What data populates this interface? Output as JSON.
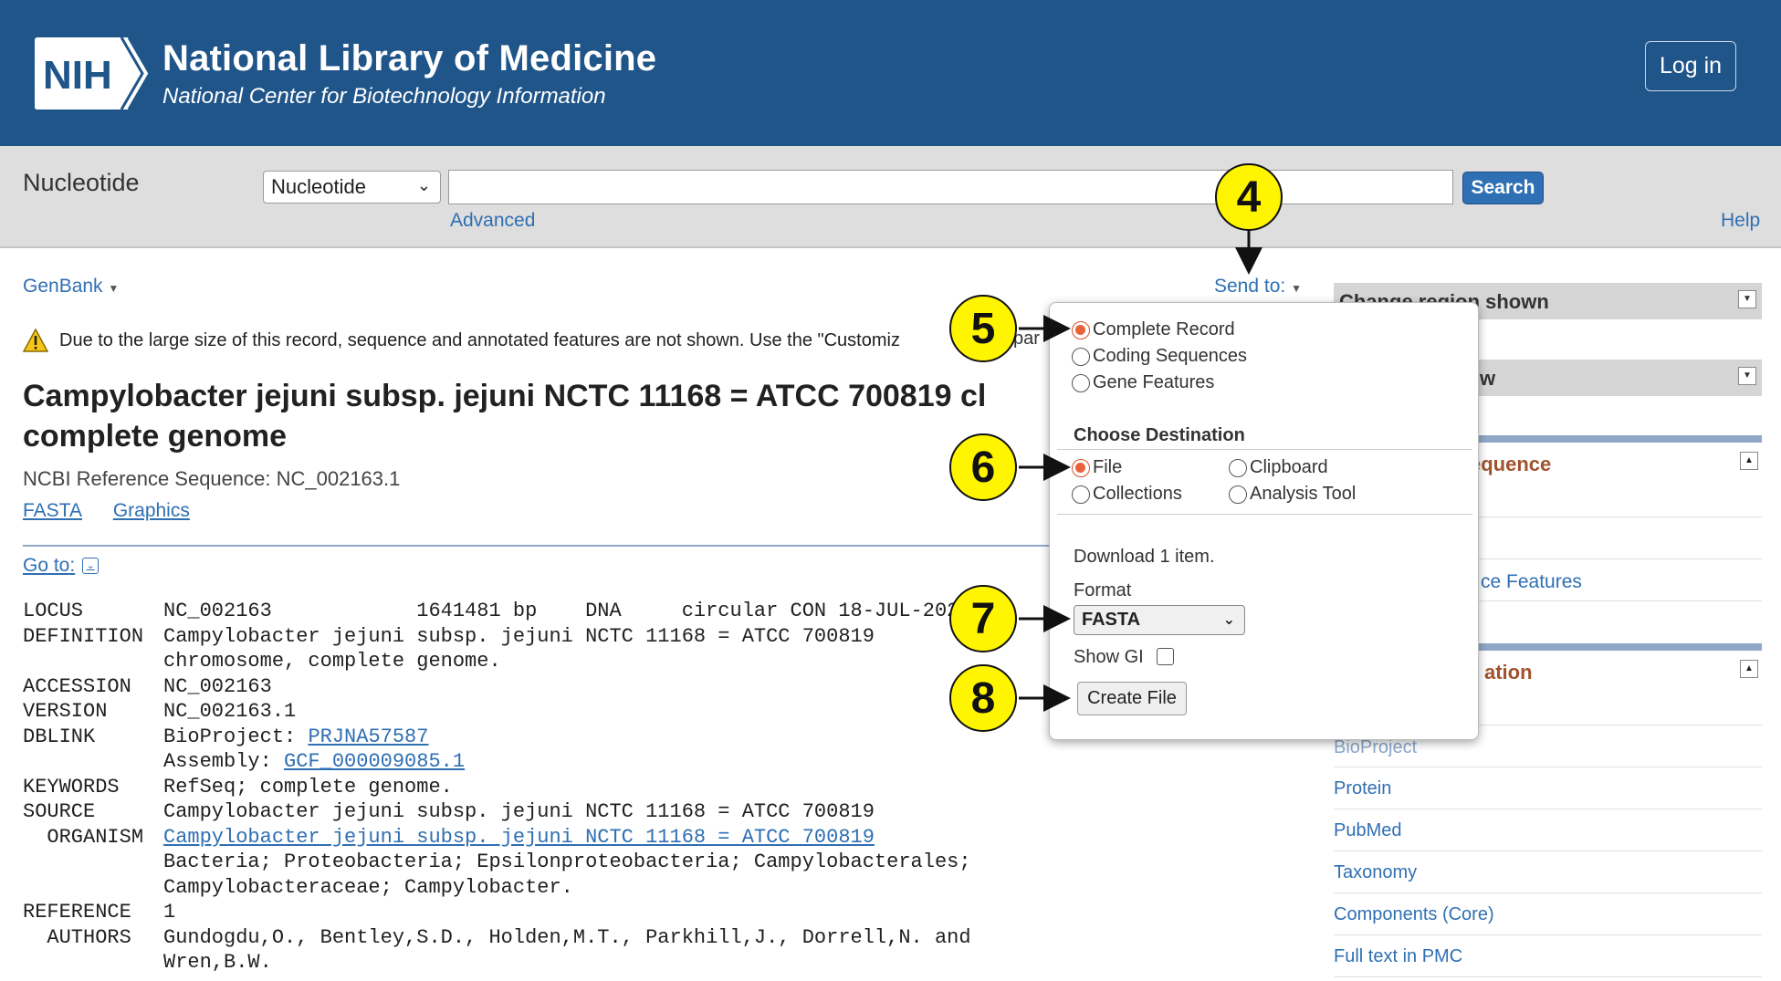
{
  "header": {
    "logo_text": "NIH",
    "title": "National Library of Medicine",
    "subtitle": "National Center for Biotechnology Information",
    "login_label": "Log in",
    "bg_color": "#20558a"
  },
  "search": {
    "db_title": "Nucleotide",
    "db_selected": "Nucleotide",
    "query": "",
    "search_label": "Search",
    "advanced_label": "Advanced",
    "help_label": "Help"
  },
  "toolbar": {
    "format_label": "GenBank",
    "sendto_label": "Send to:"
  },
  "record": {
    "warning": "Due to the large size of this record, sequence and annotated features are not shown. Use the \"Customiz",
    "warning_tail": "par",
    "title_line1": "Campylobacter jejuni subsp. jejuni NCTC 11168 = ATCC 700819 cl",
    "title_line2": "complete genome",
    "refseq": "NCBI Reference Sequence: NC_002163.1",
    "links": [
      "FASTA",
      "Graphics"
    ],
    "goto_label": "Go to:"
  },
  "genbank_rows": [
    {
      "key": "LOCUS",
      "val": "NC_002163            1641481 bp    DNA     circular CON 18-JUL-2022"
    },
    {
      "key": "DEFINITION",
      "val": "Campylobacter jejuni subsp. jejuni NCTC 11168 = ATCC 700819"
    },
    {
      "key": "",
      "val": "chromosome, complete genome."
    },
    {
      "key": "ACCESSION",
      "val": "NC_002163"
    },
    {
      "key": "VERSION",
      "val": "NC_002163.1"
    },
    {
      "key": "DBLINK",
      "val": "BioProject: ",
      "link": "PRJNA57587"
    },
    {
      "key": "",
      "val": "Assembly: ",
      "link": "GCF_000009085.1"
    },
    {
      "key": "KEYWORDS",
      "val": "RefSeq; complete genome."
    },
    {
      "key": "SOURCE",
      "val": "Campylobacter jejuni subsp. jejuni NCTC 11168 = ATCC 700819"
    },
    {
      "key": "  ORGANISM",
      "val": "",
      "link": "Campylobacter jejuni subsp. jejuni NCTC 11168 = ATCC 700819"
    },
    {
      "key": "",
      "val": "Bacteria; Proteobacteria; Epsilonproteobacteria; Campylobacterales;"
    },
    {
      "key": "",
      "val": "Campylobacteraceae; Campylobacter."
    },
    {
      "key": "REFERENCE",
      "val": "1"
    },
    {
      "key": "  AUTHORS",
      "val": "Gundogdu,O., Bentley,S.D., Holden,M.T., Parkhill,J., Dorrell,N. and"
    },
    {
      "key": "",
      "val": "Wren,B.W."
    }
  ],
  "sidebar": {
    "change_region": "Change region shown",
    "customize_view": "w",
    "section1_title": "equence",
    "seq_features": "ce Features",
    "section2_title": "ation",
    "links": [
      "BioProject",
      "Protein",
      "PubMed",
      "Taxonomy",
      "Components (Core)",
      "Full text in PMC"
    ]
  },
  "popup": {
    "record_options": [
      "Complete Record",
      "Coding Sequences",
      "Gene Features"
    ],
    "selected_record": "Complete Record",
    "destination_heading": "Choose Destination",
    "destinations": [
      "File",
      "Clipboard",
      "Collections",
      "Analysis Tool"
    ],
    "selected_destination": "File",
    "download_text": "Download 1 item.",
    "format_label": "Format",
    "format_value": "FASTA",
    "show_gi_label": "Show GI",
    "show_gi_checked": false,
    "create_label": "Create File"
  },
  "callouts": [
    "4",
    "5",
    "6",
    "7",
    "8"
  ],
  "colors": {
    "link": "#2f6fb3",
    "callout": "#fff500",
    "radio_selected": "#e8623a"
  }
}
